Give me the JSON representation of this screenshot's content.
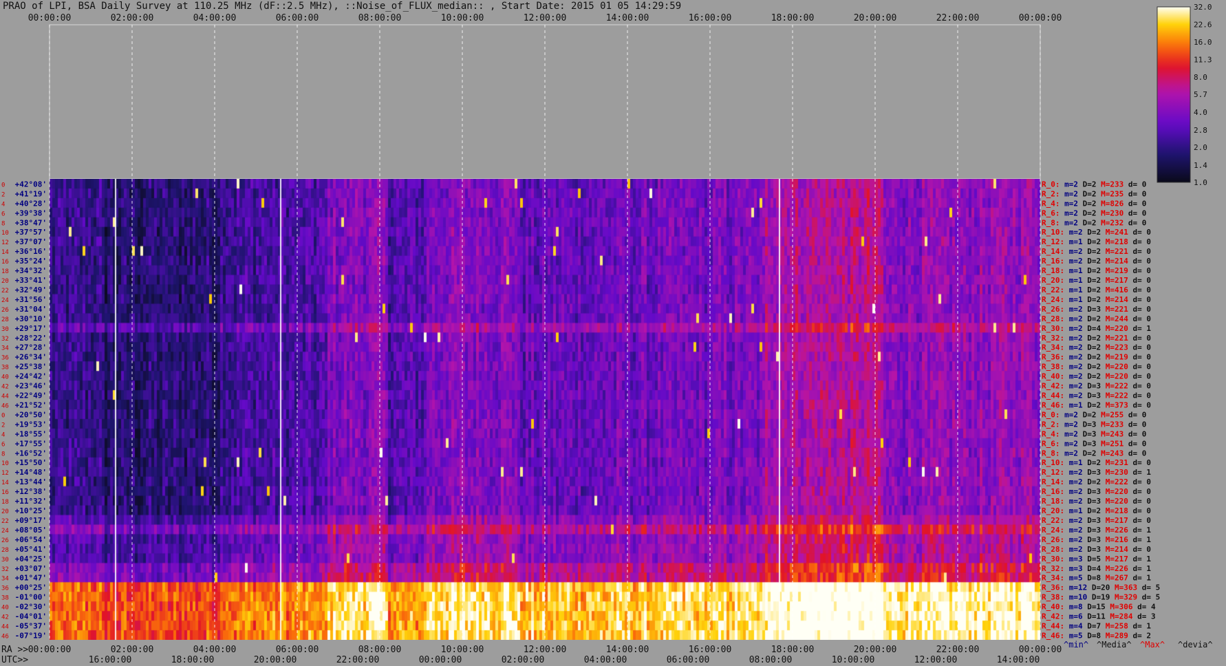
{
  "title": "PRAO of LPI, BSA Daily Survey at 110.25 MHz (dF::2.5 MHz), ::Noise_of_FLUX_median:: , Start Date: 2015 01 05 14:29:59",
  "colors": {
    "background": "#9d9d9d",
    "axis_text": "#111111",
    "row_label_red": "#cc0000",
    "row_label_blue": "#000080",
    "stat_min": "#000080",
    "stat_max": "#e00000",
    "gridline": "#ffffff"
  },
  "chart_data": {
    "type": "heatmap",
    "title": "PRAO of LPI, BSA Daily Survey at 110.25 MHz (dF::2.5 MHz), ::Noise_of_FLUX_median:: , Start Date: 2015 01 05 14:29:59",
    "top_axis_ticks": [
      "00:00:00",
      "02:00:00",
      "04:00:00",
      "06:00:00",
      "08:00:00",
      "10:00:00",
      "12:00:00",
      "14:00:00",
      "16:00:00",
      "18:00:00",
      "20:00:00",
      "22:00:00",
      "00:00:00"
    ],
    "bottom_ra_label": "RA >>",
    "bottom_ra_ticks": [
      "00:00:00",
      "02:00:00",
      "04:00:00",
      "06:00:00",
      "08:00:00",
      "10:00:00",
      "12:00:00",
      "14:00:00",
      "16:00:00",
      "18:00:00",
      "20:00:00",
      "22:00:00",
      "00:00:00"
    ],
    "bottom_utc_label": "UTC>>",
    "bottom_utc_ticks": [
      "16:00:00",
      "18:00:00",
      "20:00:00",
      "22:00:00",
      "00:00:00",
      "02:00:00",
      "04:00:00",
      "06:00:00",
      "08:00:00",
      "10:00:00",
      "12:00:00",
      "14:00:00"
    ],
    "colorbar_ticks": [
      "32.0",
      "22.6",
      "16.0",
      "11.3",
      "8.0",
      "5.7",
      "4.0",
      "2.8",
      "2.0",
      "1.4",
      "1.0"
    ],
    "colorbar_range": [
      1.0,
      32.0
    ],
    "colorbar_scale": "log",
    "footer_stats": [
      "^min^",
      "^Media^",
      "^Max^",
      "^devia^"
    ],
    "rows": [
      {
        "idx": "0",
        "dec": "+42°08'",
        "rl": "R_0:",
        "m": "2",
        "d": "2",
        "M": "233",
        "dv": "0"
      },
      {
        "idx": "2",
        "dec": "+41°19'",
        "rl": "R_2:",
        "m": "2",
        "d": "2",
        "M": "235",
        "dv": "0"
      },
      {
        "idx": "4",
        "dec": "+40°28'",
        "rl": "R_4:",
        "m": "2",
        "d": "2",
        "M": "826",
        "dv": "0"
      },
      {
        "idx": "6",
        "dec": "+39°38'",
        "rl": "R_6:",
        "m": "2",
        "d": "2",
        "M": "230",
        "dv": "0"
      },
      {
        "idx": "8",
        "dec": "+38°47'",
        "rl": "R_8:",
        "m": "2",
        "d": "2",
        "M": "232",
        "dv": "0"
      },
      {
        "idx": "10",
        "dec": "+37°57'",
        "rl": "R_10:",
        "m": "2",
        "d": "2",
        "M": "241",
        "dv": "0"
      },
      {
        "idx": "12",
        "dec": "+37°07'",
        "rl": "R_12:",
        "m": "1",
        "d": "2",
        "M": "218",
        "dv": "0"
      },
      {
        "idx": "14",
        "dec": "+36°16'",
        "rl": "R_14:",
        "m": "2",
        "d": "2",
        "M": "221",
        "dv": "0"
      },
      {
        "idx": "16",
        "dec": "+35°24'",
        "rl": "R_16:",
        "m": "2",
        "d": "2",
        "M": "214",
        "dv": "0"
      },
      {
        "idx": "18",
        "dec": "+34°32'",
        "rl": "R_18:",
        "m": "1",
        "d": "2",
        "M": "219",
        "dv": "0"
      },
      {
        "idx": "20",
        "dec": "+33°41'",
        "rl": "R_20:",
        "m": "1",
        "d": "2",
        "M": "217",
        "dv": "0"
      },
      {
        "idx": "22",
        "dec": "+32°49'",
        "rl": "R_22:",
        "m": "1",
        "d": "2",
        "M": "416",
        "dv": "0"
      },
      {
        "idx": "24",
        "dec": "+31°56'",
        "rl": "R_24:",
        "m": "1",
        "d": "2",
        "M": "214",
        "dv": "0"
      },
      {
        "idx": "26",
        "dec": "+31°04'",
        "rl": "R_26:",
        "m": "2",
        "d": "3",
        "M": "221",
        "dv": "0"
      },
      {
        "idx": "28",
        "dec": "+30°10'",
        "rl": "R_28:",
        "m": "2",
        "d": "2",
        "M": "244",
        "dv": "0"
      },
      {
        "idx": "30",
        "dec": "+29°17'",
        "rl": "R_30:",
        "m": "2",
        "d": "4",
        "M": "220",
        "dv": "1"
      },
      {
        "idx": "32",
        "dec": "+28°22'",
        "rl": "R_32:",
        "m": "2",
        "d": "2",
        "M": "221",
        "dv": "0"
      },
      {
        "idx": "34",
        "dec": "+27°28'",
        "rl": "R_34:",
        "m": "2",
        "d": "2",
        "M": "223",
        "dv": "0"
      },
      {
        "idx": "36",
        "dec": "+26°34'",
        "rl": "R_36:",
        "m": "2",
        "d": "2",
        "M": "219",
        "dv": "0"
      },
      {
        "idx": "38",
        "dec": "+25°38'",
        "rl": "R_38:",
        "m": "2",
        "d": "2",
        "M": "220",
        "dv": "0"
      },
      {
        "idx": "40",
        "dec": "+24°42'",
        "rl": "R_40:",
        "m": "2",
        "d": "2",
        "M": "220",
        "dv": "0"
      },
      {
        "idx": "42",
        "dec": "+23°46'",
        "rl": "R_42:",
        "m": "2",
        "d": "3",
        "M": "222",
        "dv": "0"
      },
      {
        "idx": "44",
        "dec": "+22°49'",
        "rl": "R_44:",
        "m": "2",
        "d": "3",
        "M": "222",
        "dv": "0"
      },
      {
        "idx": "46",
        "dec": "+21°52'",
        "rl": "R_46:",
        "m": "1",
        "d": "2",
        "M": "373",
        "dv": "0"
      },
      {
        "idx": "0",
        "dec": "+20°50'",
        "rl": "R_0:",
        "m": "2",
        "d": "2",
        "M": "255",
        "dv": "0"
      },
      {
        "idx": "2",
        "dec": "+19°53'",
        "rl": "R_2:",
        "m": "2",
        "d": "3",
        "M": "233",
        "dv": "0"
      },
      {
        "idx": "4",
        "dec": "+18°55'",
        "rl": "R_4:",
        "m": "2",
        "d": "3",
        "M": "243",
        "dv": "0"
      },
      {
        "idx": "6",
        "dec": "+17°55'",
        "rl": "R_6:",
        "m": "2",
        "d": "3",
        "M": "251",
        "dv": "0"
      },
      {
        "idx": "8",
        "dec": "+16°52'",
        "rl": "R_8:",
        "m": "2",
        "d": "2",
        "M": "243",
        "dv": "0"
      },
      {
        "idx": "10",
        "dec": "+15°50'",
        "rl": "R_10:",
        "m": "1",
        "d": "2",
        "M": "231",
        "dv": "0"
      },
      {
        "idx": "12",
        "dec": "+14°48'",
        "rl": "R_12:",
        "m": "2",
        "d": "3",
        "M": "230",
        "dv": "1"
      },
      {
        "idx": "14",
        "dec": "+13°44'",
        "rl": "R_14:",
        "m": "2",
        "d": "2",
        "M": "222",
        "dv": "0"
      },
      {
        "idx": "16",
        "dec": "+12°38'",
        "rl": "R_16:",
        "m": "2",
        "d": "3",
        "M": "220",
        "dv": "0"
      },
      {
        "idx": "18",
        "dec": "+11°32'",
        "rl": "R_18:",
        "m": "2",
        "d": "3",
        "M": "220",
        "dv": "0"
      },
      {
        "idx": "20",
        "dec": "+10°25'",
        "rl": "R_20:",
        "m": "1",
        "d": "2",
        "M": "218",
        "dv": "0"
      },
      {
        "idx": "22",
        "dec": "+09°17'",
        "rl": "R_22:",
        "m": "2",
        "d": "3",
        "M": "217",
        "dv": "0"
      },
      {
        "idx": "24",
        "dec": "+08°05'",
        "rl": "R_24:",
        "m": "2",
        "d": "3",
        "M": "226",
        "dv": "1"
      },
      {
        "idx": "26",
        "dec": "+06°54'",
        "rl": "R_26:",
        "m": "2",
        "d": "3",
        "M": "216",
        "dv": "1"
      },
      {
        "idx": "28",
        "dec": "+05°41'",
        "rl": "R_28:",
        "m": "2",
        "d": "3",
        "M": "214",
        "dv": "0"
      },
      {
        "idx": "30",
        "dec": "+04°25'",
        "rl": "R_30:",
        "m": "3",
        "d": "5",
        "M": "217",
        "dv": "1"
      },
      {
        "idx": "32",
        "dec": "+03°07'",
        "rl": "R_32:",
        "m": "3",
        "d": "4",
        "M": "226",
        "dv": "1"
      },
      {
        "idx": "34",
        "dec": "+01°47'",
        "rl": "R_34:",
        "m": "5",
        "d": "8",
        "M": "267",
        "dv": "1"
      },
      {
        "idx": "36",
        "dec": "+00°25'",
        "rl": "R_36:",
        "m": "12",
        "d": "20",
        "M": "363",
        "dv": "5"
      },
      {
        "idx": "38",
        "dec": "-01°00'",
        "rl": "R_38:",
        "m": "10",
        "d": "19",
        "M": "329",
        "dv": "5"
      },
      {
        "idx": "40",
        "dec": "-02°30'",
        "rl": "R_40:",
        "m": "8",
        "d": "15",
        "M": "306",
        "dv": "4"
      },
      {
        "idx": "42",
        "dec": "-04°01'",
        "rl": "R_42:",
        "m": "6",
        "d": "11",
        "M": "284",
        "dv": "3"
      },
      {
        "idx": "44",
        "dec": "-05°37'",
        "rl": "R_44:",
        "m": "4",
        "d": "7",
        "M": "258",
        "dv": "1"
      },
      {
        "idx": "46",
        "dec": "-07°19'",
        "rl": "R_46:",
        "m": "5",
        "d": "8",
        "M": "289",
        "dv": "2"
      }
    ]
  }
}
